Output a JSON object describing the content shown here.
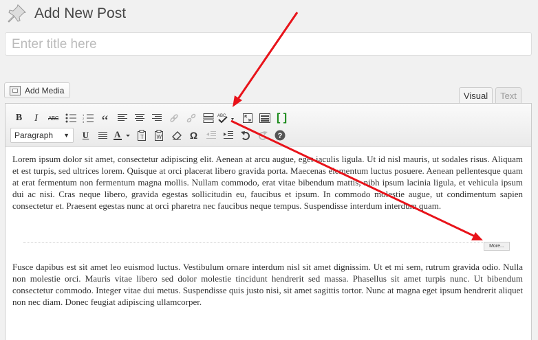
{
  "header": {
    "title": "Add New Post",
    "icon": "pushpin-icon"
  },
  "title_field": {
    "placeholder": "Enter title here",
    "value": ""
  },
  "media": {
    "add_media_label": "Add Media"
  },
  "tabs": {
    "visual_label": "Visual",
    "text_label": "Text",
    "active": "Visual"
  },
  "toolbar": {
    "format_select": "Paragraph",
    "row1_icons": [
      "bold-icon",
      "italic-icon",
      "strikethrough-icon",
      "bullet-list-icon",
      "numbered-list-icon",
      "blockquote-icon",
      "align-left-icon",
      "align-center-icon",
      "align-right-icon",
      "link-icon",
      "unlink-icon",
      "insert-more-tag-icon",
      "spellcheck-icon",
      "fullscreen-icon",
      "kitchen-sink-icon",
      "shortcode-icon"
    ],
    "row2_icons": [
      "underline-icon",
      "justify-icon",
      "text-color-icon",
      "paste-as-text-icon",
      "paste-from-word-icon",
      "clear-formatting-icon",
      "special-character-icon",
      "outdent-icon",
      "indent-icon",
      "undo-icon",
      "redo-icon",
      "help-icon"
    ],
    "labels": {
      "bold": "B",
      "italic": "I",
      "strike": "ABC",
      "quote": "“",
      "underline": "U",
      "text_color": "A",
      "omega": "Ω",
      "spell": "ABC",
      "help": "?",
      "shortcode": "[ ]"
    }
  },
  "content": {
    "paragraph1": "Lorem ipsum dolor sit amet, consectetur adipiscing elit. Aenean at arcu augue, eget iaculis ligula. Ut id nisl mauris, ut sodales risus. Aliquam et est turpis, sed ultrices lorem. Quisque at orci placerat libero gravida porta. Maecenas elementum luctus posuere. Aenean pellentesque quam at erat fermentum non fermentum magna mollis. Nullam commodo, erat vitae bibendum mattis, nibh ipsum lacinia ligula, et vehicula ipsum dui ac nisi. Cras neque libero, gravida egestas sollicitudin eu, faucibus et ipsum. In commodo molestie augue, ut condimentum sapien consectetur et. Praesent egestas nunc at orci pharetra nec faucibus neque tempus. Suspendisse interdum interdum quam.",
    "more_tag": "More...",
    "paragraph2": "Fusce dapibus est sit amet leo euismod luctus. Vestibulum ornare interdum nisl sit amet dignissim. Ut et mi sem, rutrum gravida odio. Nulla non molestie orci. Mauris vitae libero sed dolor molestie tincidunt hendrerit sed massa. Phasellus sit amet turpis nunc. Ut bibendum consectetur commodo. Integer vitae dui metus. Suspendisse quis justo nisi, sit amet sagittis tortor. Nunc at magna eget ipsum hendrerit aliquet non nec diam. Donec feugiat adipiscing ullamcorper."
  },
  "colors": {
    "annotation_arrow": "#e8131a",
    "accent_green": "#1a8a1a"
  }
}
